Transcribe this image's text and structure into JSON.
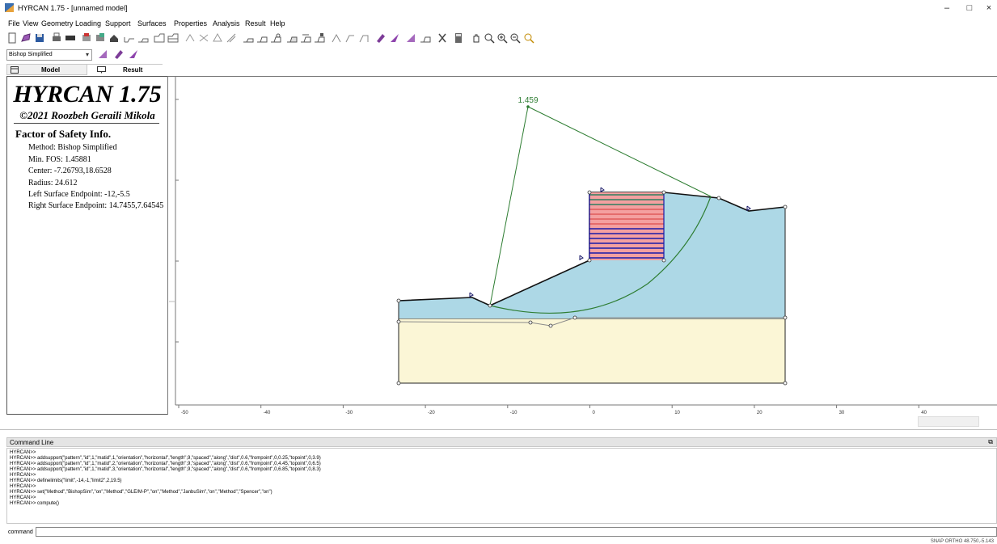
{
  "window": {
    "title": "HYRCAN 1.75 - [unnamed model]",
    "minimize": "–",
    "restore": "□",
    "close": "×"
  },
  "menu": [
    "File",
    "View",
    "Geometry",
    "Loading",
    "Support",
    "Surfaces",
    "Properties",
    "Analysis",
    "Result",
    "Help"
  ],
  "method_selector": {
    "value": "Bishop Simplified"
  },
  "tabs": {
    "model": "Model",
    "result": "Result"
  },
  "brand": {
    "title": "HYRCAN 1.75",
    "subtitle": "©2021 Roozbeh Geraili Mikola"
  },
  "fos_info": {
    "heading": "Factor of Safety Info.",
    "lines": [
      "Method: Bishop Simplified",
      "Min. FOS: 1.45881",
      "Center: -7.26793,18.6528",
      "Radius: 24.612",
      "Left Surface Endpoint: -12,-5.5",
      "Right Surface Endpoint: 14.7455,7.64545"
    ]
  },
  "canvas": {
    "fos_label": "1.459",
    "x_ticks": [
      "-50",
      "-40",
      "-30",
      "-20",
      "-10",
      "0",
      "10",
      "20",
      "30",
      "40"
    ],
    "colors": {
      "layer_upper": "#add8e6",
      "layer_lower": "#fbf6d6",
      "slip": "#2e7d32",
      "support_red": "#f08080",
      "support_blue": "#1a1aa8"
    }
  },
  "command": {
    "header": "Command Line",
    "label": "command",
    "history": [
      "HYRCAN>>",
      "HYRCAN>> addsupport(\"pattern\",\"id\",1,\"matid\",1,\"orientation\",\"horizontal\",\"length\",9,\"spaced\",\"along\",\"dist\",0.6,\"frompoint\",0,0.25,\"topoint\",0,3.9)",
      "HYRCAN>> addsupport(\"pattern\",\"id\",1,\"matid\",2,\"orientation\",\"horizontal\",\"length\",9,\"spaced\",\"along\",\"dist\",0.6,\"frompoint\",0,4.45,\"topoint\",0,6.5)",
      "HYRCAN>> addsupport(\"pattern\",\"id\",1,\"matid\",3,\"orientation\",\"horizontal\",\"length\",9,\"spaced\",\"along\",\"dist\",0.6,\"frompoint\",0,6.85,\"topoint\",0,8.3)",
      "HYRCAN>>",
      "HYRCAN>> definelimits(\"limit\",-14,-1,\"limit2\",2,19.5)",
      "HYRCAN>>",
      "HYRCAN>> set(\"Method\",\"BishopSim\",\"on\",\"Method\",\"GLE/M-P\",\"on\",\"Method\",\"JanbuSim\",\"on\",\"Method\",\"Spencer\",\"on\")",
      "HYRCAN>>",
      "HYRCAN>> compute()"
    ]
  },
  "status": {
    "text": "SNAP  ORTHO    48.750,-5.143"
  }
}
